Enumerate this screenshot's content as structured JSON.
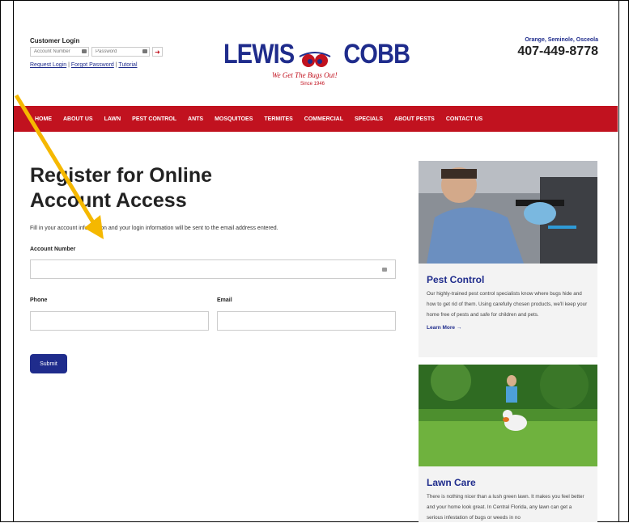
{
  "login": {
    "title": "Customer Login",
    "account_placeholder": "Account Number",
    "password_placeholder": "Password",
    "go_icon": "arrow-right-icon",
    "links": [
      "Request Login",
      "Forgot Password",
      "Tutorial"
    ],
    "separator": "|"
  },
  "logo": {
    "left": "LEWIS",
    "right": "COBB",
    "tagline": "We Get The Bugs Out!",
    "since": "Since 1946"
  },
  "contact": {
    "counties": "Orange, Seminole, Osceola",
    "phone": "407-449-8778"
  },
  "nav": [
    "HOME",
    "ABOUT US",
    "LAWN",
    "PEST CONTROL",
    "ANTS",
    "MOSQUITOES",
    "TERMITES",
    "COMMERCIAL",
    "SPECIALS",
    "ABOUT PESTS",
    "CONTACT US"
  ],
  "form": {
    "title_line1": "Register for Online",
    "title_line2": "Account Access",
    "intro": "Fill in your account information and your login information will be sent to the email address entered.",
    "account_label": "Account Number",
    "phone_label": "Phone",
    "email_label": "Email",
    "submit": "Submit"
  },
  "cards": [
    {
      "title": "Pest Control",
      "text": "Our highly-trained pest control specialists know where bugs hide and how to get rid of them. Using carefully chosen products, we'll keep your home free of pests and safe for children and pets.",
      "more": "Learn More →"
    },
    {
      "title": "Lawn Care",
      "text": "There is nothing nicer than a lush green lawn. It makes you feel better and your home look great. In Central Florida, any lawn can get a serious infestation of bugs or weeds in no",
      "more": ""
    }
  ],
  "colors": {
    "brand_red": "#c1121f",
    "brand_blue": "#1f2c8c",
    "annotation_arrow": "#f5b800"
  }
}
